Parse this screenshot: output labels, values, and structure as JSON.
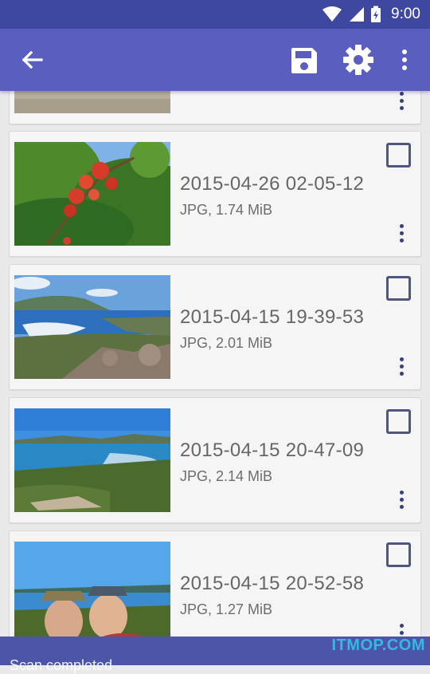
{
  "status_bar": {
    "time": "9:00"
  },
  "app_bar": {
    "back_icon": "arrow-left-icon",
    "save_icon": "save-icon",
    "settings_icon": "gear-icon",
    "more_icon": "more-vertical-icon"
  },
  "items": [
    {
      "title": "2015-04-26 02-05-12",
      "meta": "JPG, 1.74 MiB",
      "checked": false
    },
    {
      "title": "2015-04-15 19-39-53",
      "meta": "JPG, 2.01 MiB",
      "checked": false
    },
    {
      "title": "2015-04-15 20-47-09",
      "meta": "JPG, 2.14 MiB",
      "checked": false
    },
    {
      "title": "2015-04-15 20-52-58",
      "meta": "JPG, 1.27 MiB",
      "checked": false
    }
  ],
  "snackbar": {
    "message": "Scan completed"
  },
  "watermark": "ITMOP.COM",
  "colors": {
    "primary": "#5a5fbf",
    "primary_dark": "#3f48a0",
    "accent": "#4d5580"
  }
}
